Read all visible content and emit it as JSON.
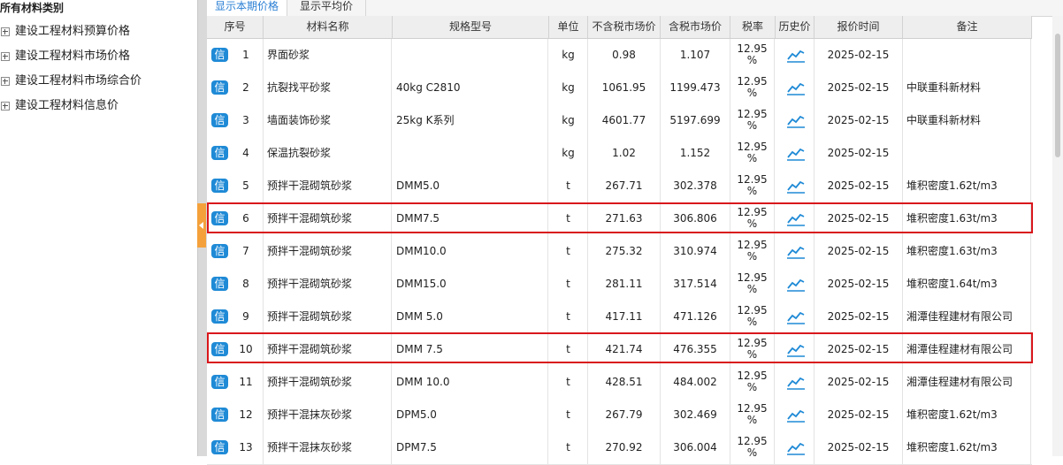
{
  "tree": {
    "title": "所有材料类别",
    "items": [
      {
        "label": "建设工程材料预算价格"
      },
      {
        "label": "建设工程材料市场价格"
      },
      {
        "label": "建设工程材料市场综合价"
      },
      {
        "label": "建设工程材料信息价"
      }
    ]
  },
  "tabs": [
    {
      "label": "显示本期价格",
      "active": true
    },
    {
      "label": "显示平均价",
      "active": false
    }
  ],
  "grid": {
    "headers": [
      "序号",
      "材料名称",
      "规格型号",
      "单位",
      "不含税市场价",
      "含税市场价",
      "税率",
      "历史价",
      "报价时间",
      "备注"
    ],
    "badge_label": "信",
    "rows": [
      {
        "seq": "1",
        "name": "界面砂浆",
        "spec": "",
        "unit": "kg",
        "price": "0.98",
        "price_tax": "1.107",
        "tax_a": "12.95",
        "tax_b": "%",
        "date": "2025-02-15",
        "note": ""
      },
      {
        "seq": "2",
        "name": "抗裂找平砂浆",
        "spec": "40kg C2810",
        "unit": "kg",
        "price": "1061.95",
        "price_tax": "1199.473",
        "tax_a": "12.95",
        "tax_b": "%",
        "date": "2025-02-15",
        "note": "中联重科新材料"
      },
      {
        "seq": "3",
        "name": "墙面装饰砂浆",
        "spec": "25kg K系列",
        "unit": "kg",
        "price": "4601.77",
        "price_tax": "5197.699",
        "tax_a": "12.95",
        "tax_b": "%",
        "date": "2025-02-15",
        "note": "中联重科新材料"
      },
      {
        "seq": "4",
        "name": "保温抗裂砂浆",
        "spec": "",
        "unit": "kg",
        "price": "1.02",
        "price_tax": "1.152",
        "tax_a": "12.95",
        "tax_b": "%",
        "date": "2025-02-15",
        "note": ""
      },
      {
        "seq": "5",
        "name": "预拌干混砌筑砂浆",
        "spec": "DMM5.0",
        "unit": "t",
        "price": "267.71",
        "price_tax": "302.378",
        "tax_a": "12.95",
        "tax_b": "%",
        "date": "2025-02-15",
        "note": "堆积密度1.62t/m3"
      },
      {
        "seq": "6",
        "name": "预拌干混砌筑砂浆",
        "spec": "DMM7.5",
        "unit": "t",
        "price": "271.63",
        "price_tax": "306.806",
        "tax_a": "12.95",
        "tax_b": "%",
        "date": "2025-02-15",
        "note": "堆积密度1.63t/m3"
      },
      {
        "seq": "7",
        "name": "预拌干混砌筑砂浆",
        "spec": "DMM10.0",
        "unit": "t",
        "price": "275.32",
        "price_tax": "310.974",
        "tax_a": "12.95",
        "tax_b": "%",
        "date": "2025-02-15",
        "note": "堆积密度1.63t/m3"
      },
      {
        "seq": "8",
        "name": "预拌干混砌筑砂浆",
        "spec": "DMM15.0",
        "unit": "t",
        "price": "281.11",
        "price_tax": "317.514",
        "tax_a": "12.95",
        "tax_b": "%",
        "date": "2025-02-15",
        "note": "堆积密度1.64t/m3"
      },
      {
        "seq": "9",
        "name": "预拌干混砌筑砂浆",
        "spec": "DMM 5.0",
        "unit": "t",
        "price": "417.11",
        "price_tax": "471.126",
        "tax_a": "12.95",
        "tax_b": "%",
        "date": "2025-02-15",
        "note": "湘潭佳程建材有限公司"
      },
      {
        "seq": "10",
        "name": "预拌干混砌筑砂浆",
        "spec": "DMM 7.5",
        "unit": "t",
        "price": "421.74",
        "price_tax": "476.355",
        "tax_a": "12.95",
        "tax_b": "%",
        "date": "2025-02-15",
        "note": "湘潭佳程建材有限公司"
      },
      {
        "seq": "11",
        "name": "预拌干混砌筑砂浆",
        "spec": "DMM 10.0",
        "unit": "t",
        "price": "428.51",
        "price_tax": "484.002",
        "tax_a": "12.95",
        "tax_b": "%",
        "date": "2025-02-15",
        "note": "湘潭佳程建材有限公司"
      },
      {
        "seq": "12",
        "name": "预拌干混抹灰砂浆",
        "spec": "DPM5.0",
        "unit": "t",
        "price": "267.79",
        "price_tax": "302.469",
        "tax_a": "12.95",
        "tax_b": "%",
        "date": "2025-02-15",
        "note": "堆积密度1.62t/m3"
      },
      {
        "seq": "13",
        "name": "预拌干混抹灰砂浆",
        "spec": "DPM7.5",
        "unit": "t",
        "price": "270.92",
        "price_tax": "306.004",
        "tax_a": "12.95",
        "tax_b": "%",
        "date": "2025-02-15",
        "note": "堆积密度1.62t/m3"
      }
    ]
  },
  "colors": {
    "badge": "#1f8ad6",
    "highlight": "#d9171c",
    "active_tab": "#2a7fd4",
    "collapse_tab": "#f4a13b"
  }
}
